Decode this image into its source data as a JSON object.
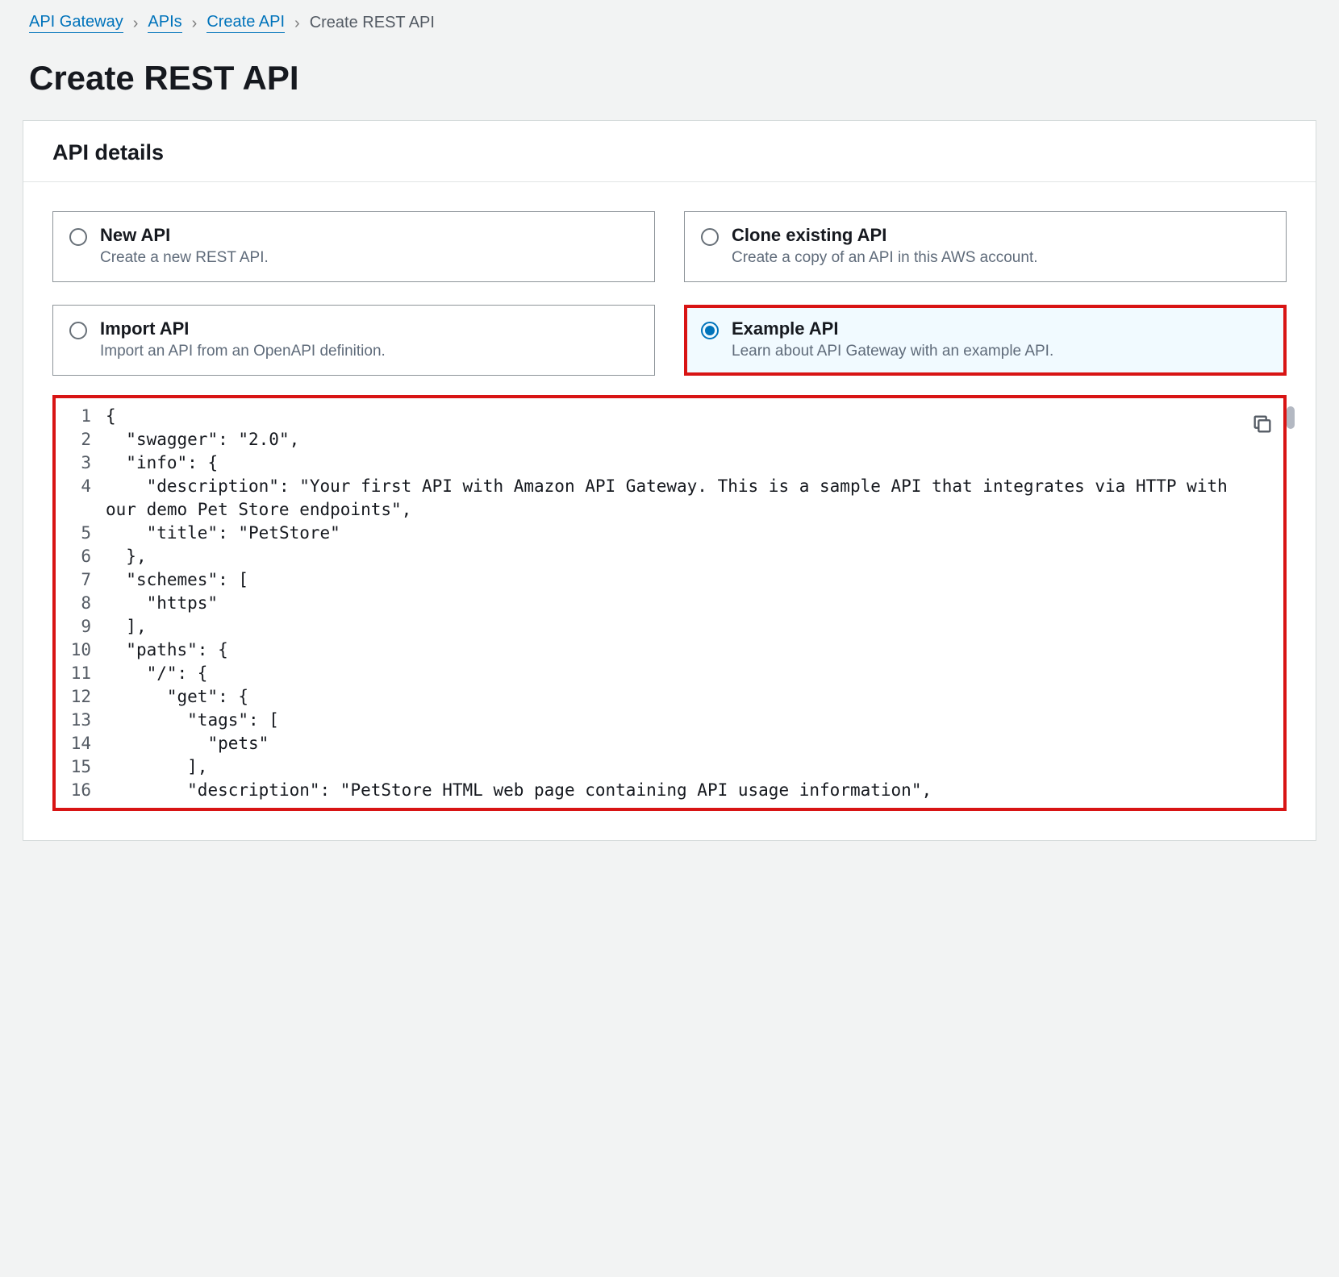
{
  "breadcrumb": {
    "items": [
      {
        "label": "API Gateway",
        "link": true
      },
      {
        "label": "APIs",
        "link": true
      },
      {
        "label": "Create API",
        "link": true
      },
      {
        "label": "Create REST API",
        "link": false
      }
    ]
  },
  "page": {
    "title": "Create REST API"
  },
  "panel": {
    "header": "API details"
  },
  "options": [
    {
      "id": "new-api",
      "title": "New API",
      "desc": "Create a new REST API.",
      "selected": false
    },
    {
      "id": "clone-api",
      "title": "Clone existing API",
      "desc": "Create a copy of an API in this AWS account.",
      "selected": false
    },
    {
      "id": "import-api",
      "title": "Import API",
      "desc": "Import an API from an OpenAPI definition.",
      "selected": false
    },
    {
      "id": "example-api",
      "title": "Example API",
      "desc": "Learn about API Gateway with an example API.",
      "selected": true
    }
  ],
  "codeLines": [
    "{",
    "  \"swagger\": \"2.0\",",
    "  \"info\": {",
    "    \"description\": \"Your first API with Amazon API Gateway. This is a sample API that integrates via HTTP with our demo Pet Store endpoints\",",
    "    \"title\": \"PetStore\"",
    "  },",
    "  \"schemes\": [",
    "    \"https\"",
    "  ],",
    "  \"paths\": {",
    "    \"/\": {",
    "      \"get\": {",
    "        \"tags\": [",
    "          \"pets\"",
    "        ],",
    "        \"description\": \"PetStore HTML web page containing API usage information\","
  ]
}
